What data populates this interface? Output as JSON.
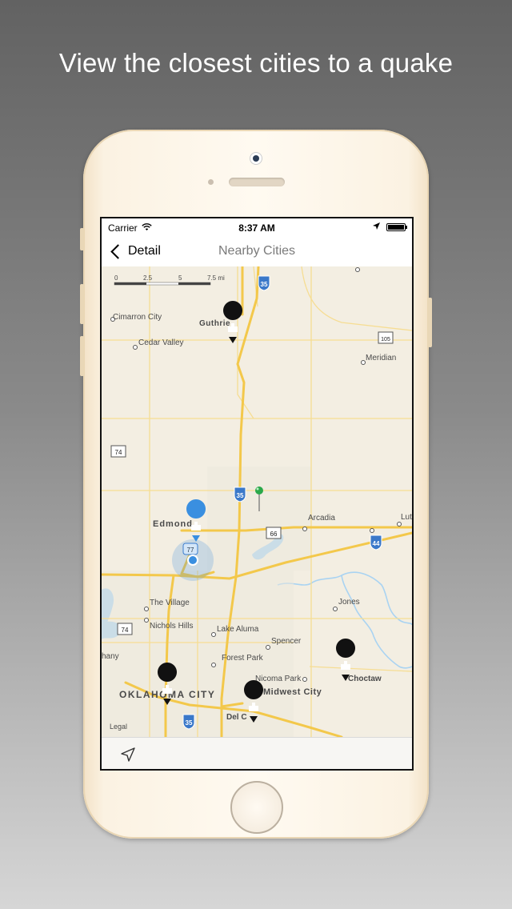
{
  "headline": "View the closest cities to a quake",
  "status_bar": {
    "carrier": "Carrier",
    "time": "8:37 AM"
  },
  "nav": {
    "back_label": "Detail",
    "title": "Nearby Cities"
  },
  "scale_bar": {
    "ticks": [
      "0",
      "2.5",
      "5",
      "7.5 mi"
    ]
  },
  "map": {
    "places": {
      "cimarron_city": "Cimarron City",
      "guthrie": "Guthrie",
      "cedar_valley": "Cedar Valley",
      "meridian": "Meridian",
      "edmond": "Edmond",
      "arcadia": "Arcadia",
      "luther": "Lut",
      "the_village": "The Village",
      "nichols_hills": "Nichols Hills",
      "lake_aluma": "Lake Aluma",
      "jones": "Jones",
      "spencer": "Spencer",
      "forest_park": "Forest Park",
      "bethany": "hany",
      "nicoma_park": "Nicoma Park",
      "choctaw": "Choctaw",
      "midwest_city": "Midwest City",
      "oklahoma_city": "OKLAHOMA CITY",
      "del_city": "Del C",
      "legal": "Legal"
    },
    "shields": {
      "i35_top": "35",
      "ok105": "105",
      "ok74_north": "74",
      "i35_mid": "35",
      "ok66": "66",
      "i44": "44",
      "ok77": "77",
      "ok74_south": "74",
      "i35_south": "35"
    },
    "colors": {
      "land": "#f3eee2",
      "road": "#f3c84b",
      "water": "#a9d3f2",
      "interstate": "#3a78c9",
      "user_pin": "#3a8fe0",
      "quake_pin": "#2aa84a"
    }
  }
}
